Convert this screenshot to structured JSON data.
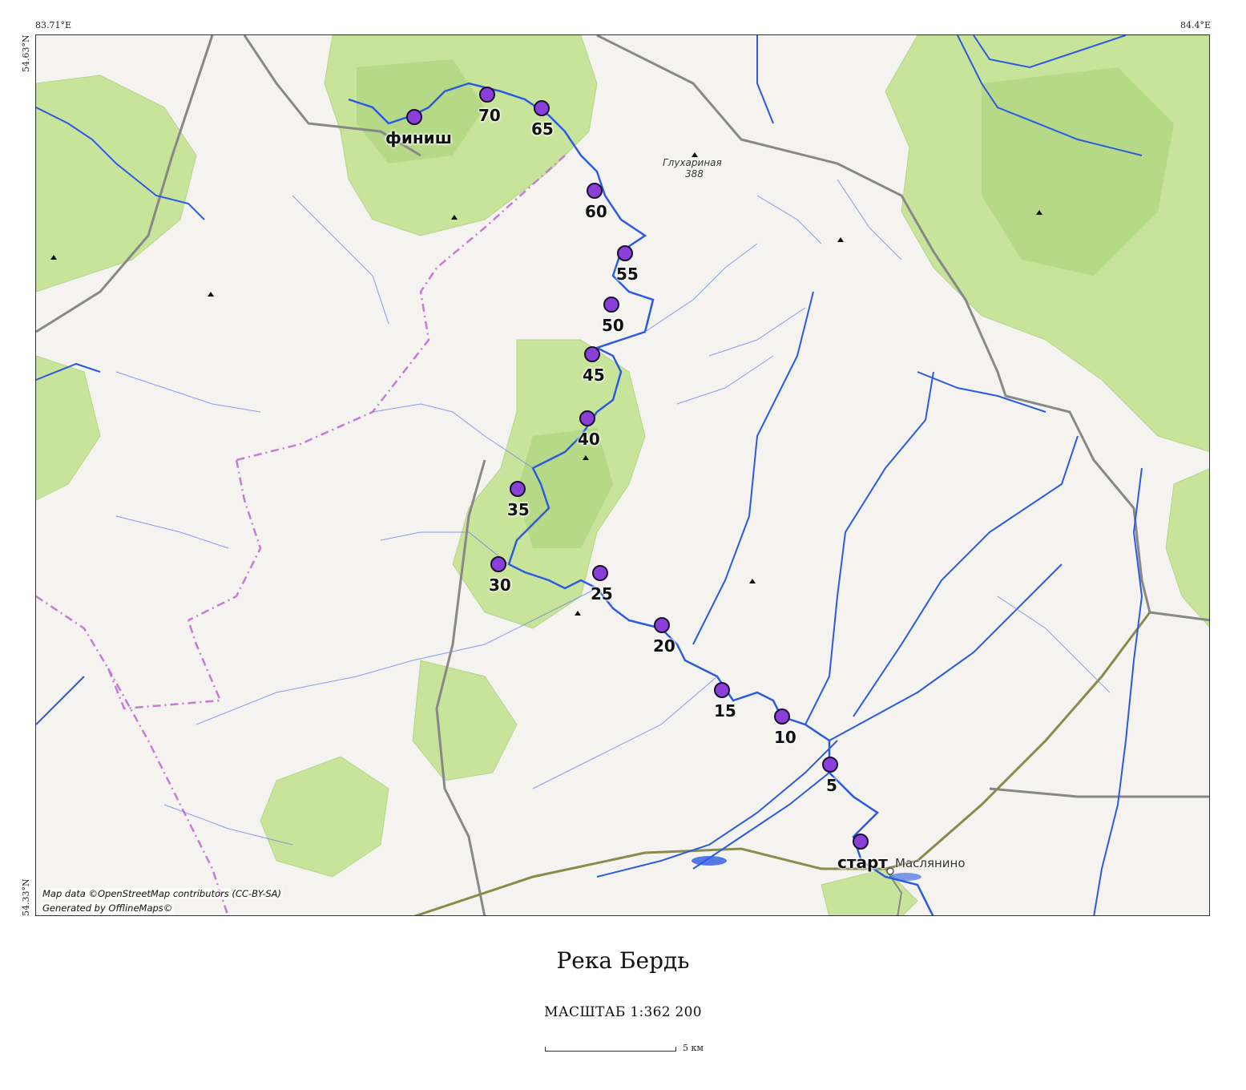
{
  "map": {
    "title": "Река Бердь",
    "scale_text": "МАСШТАБ  1:362 200",
    "scale_bar_label": "5 км",
    "attribution_line1": "Map data ©OpenStreetMap contributors (CC-BY-SA)",
    "attribution_line2": "Generated by OfflineMaps©",
    "coords": {
      "top_left": "83.71°E",
      "top_right": "84.4°E",
      "left_top": "54.63°N",
      "left_bottom": "54.33°N"
    },
    "places": {
      "peak_name": "Глухариная",
      "peak_elevation": "388",
      "town": "Маслянино"
    },
    "markers": [
      {
        "label": "финиш",
        "kind": "finish"
      },
      {
        "label": "70",
        "kind": "km"
      },
      {
        "label": "65",
        "kind": "km"
      },
      {
        "label": "60",
        "kind": "km"
      },
      {
        "label": "55",
        "kind": "km"
      },
      {
        "label": "50",
        "kind": "km"
      },
      {
        "label": "45",
        "kind": "km"
      },
      {
        "label": "40",
        "kind": "km"
      },
      {
        "label": "35",
        "kind": "km"
      },
      {
        "label": "30",
        "kind": "km"
      },
      {
        "label": "25",
        "kind": "km"
      },
      {
        "label": "20",
        "kind": "km"
      },
      {
        "label": "15",
        "kind": "km"
      },
      {
        "label": "10",
        "kind": "km"
      },
      {
        "label": "5",
        "kind": "km"
      },
      {
        "label": "старт",
        "kind": "start"
      }
    ],
    "colors": {
      "marker_fill": "#8b3fd9",
      "river": "#2a5be0",
      "forest": "#c8e39a",
      "forest_dark": "#a9d27a",
      "boundary": "#c77ad6",
      "road": "#888888"
    }
  }
}
